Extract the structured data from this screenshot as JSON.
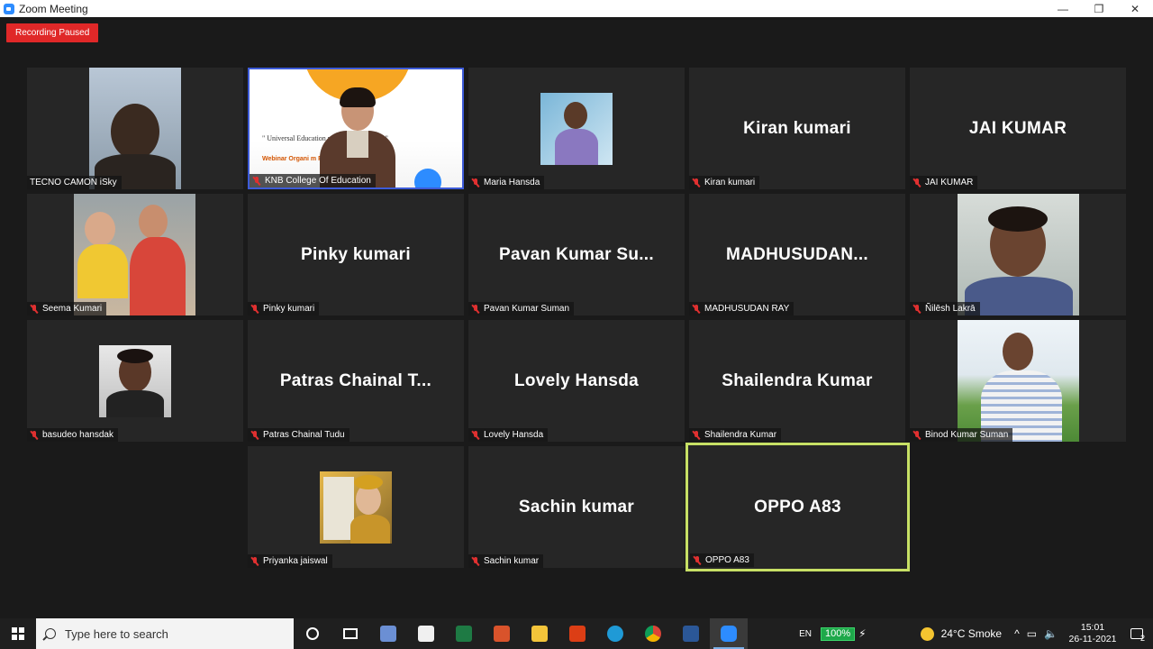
{
  "window": {
    "title": "Zoom Meeting",
    "minimize": "—",
    "maximize": "❐",
    "close": "✕"
  },
  "recording": {
    "label": "Recording Paused"
  },
  "tiles": [
    {
      "id": "tecno",
      "label": "TECNO CAMON iSky",
      "muted": false,
      "type": "video"
    },
    {
      "id": "knb",
      "label": "KNB College Of Education",
      "muted": true,
      "type": "slide",
      "slide_text": "\" Universal Education               nstitution's mandate\"",
      "slide_small": "Webinar              Organi                                    m Platform"
    },
    {
      "id": "maria",
      "label": "Maria Hansda",
      "muted": true,
      "type": "photo"
    },
    {
      "id": "kiran",
      "label": "Kiran kumari",
      "muted": true,
      "type": "name",
      "display": "Kiran kumari"
    },
    {
      "id": "jai",
      "label": "JAI KUMAR",
      "muted": true,
      "type": "name",
      "display": "JAI KUMAR"
    },
    {
      "id": "seema",
      "label": "Seema Kumari",
      "muted": true,
      "type": "photo"
    },
    {
      "id": "pinky",
      "label": "Pinky kumari",
      "muted": true,
      "type": "name",
      "display": "Pinky kumari"
    },
    {
      "id": "pavan",
      "label": "Pavan Kumar Suman",
      "muted": true,
      "type": "name",
      "display": "Pavan Kumar Su..."
    },
    {
      "id": "madhu",
      "label": "MADHUSUDAN RAY",
      "muted": true,
      "type": "name",
      "display": "MADHUSUDAN..."
    },
    {
      "id": "nilesh",
      "label": "Ñilēsh Lakrā",
      "muted": true,
      "type": "photo"
    },
    {
      "id": "basudeo",
      "label": "basudeo hansdak",
      "muted": true,
      "type": "photo"
    },
    {
      "id": "patras",
      "label": "Patras Chainal Tudu",
      "muted": true,
      "type": "name",
      "display": "Patras Chainal T..."
    },
    {
      "id": "lovely",
      "label": "Lovely Hansda",
      "muted": true,
      "type": "name",
      "display": "Lovely Hansda"
    },
    {
      "id": "shailendra",
      "label": "Shailendra Kumar",
      "muted": true,
      "type": "name",
      "display": "Shailendra Kumar"
    },
    {
      "id": "binod",
      "label": "Binod Kumar Suman",
      "muted": true,
      "type": "photo"
    },
    {
      "id": "priyanka",
      "label": "Priyanka jaiswal",
      "muted": true,
      "type": "photo"
    },
    {
      "id": "sachin",
      "label": "Sachin kumar",
      "muted": true,
      "type": "name",
      "display": "Sachin kumar"
    },
    {
      "id": "oppo",
      "label": "OPPO A83",
      "muted": true,
      "type": "name",
      "display": "OPPO A83",
      "active": true
    }
  ],
  "taskbar": {
    "search_placeholder": "Type here to search",
    "language": "EN",
    "battery": "100%",
    "weather": "24°C  Smoke",
    "time": "15:01",
    "date": "26-11-2021",
    "notifications": "2"
  },
  "colors": {
    "active_speaker": "#c7e065",
    "recording": "#e02828",
    "mute": "#e03030"
  }
}
